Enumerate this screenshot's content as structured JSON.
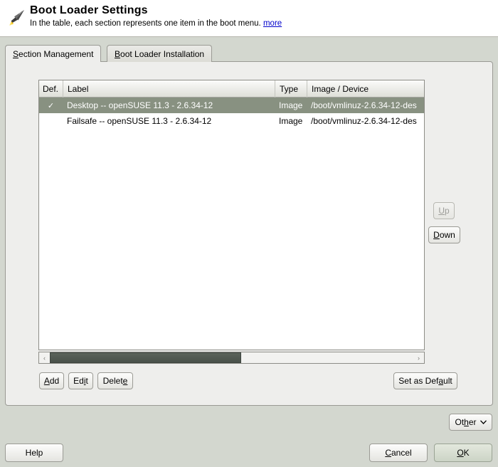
{
  "header": {
    "icon": "yast-rocket-icon",
    "title": "Boot Loader Settings",
    "subtitle": "In the table, each section represents one item in the boot menu.",
    "more_link": "more"
  },
  "tabs": [
    {
      "label": "Section Management",
      "mnemonic": "S",
      "active": true
    },
    {
      "label": "Boot Loader Installation",
      "mnemonic": "B",
      "active": false
    }
  ],
  "table": {
    "columns": [
      {
        "key": "def",
        "header": "Def."
      },
      {
        "key": "label",
        "header": "Label"
      },
      {
        "key": "type",
        "header": "Type"
      },
      {
        "key": "image",
        "header": "Image / Device"
      }
    ],
    "rows": [
      {
        "def": "✓",
        "label": "Desktop -- openSUSE 11.3 - 2.6.34-12",
        "type": "Image",
        "image": "/boot/vmlinuz-2.6.34-12-des",
        "selected": true
      },
      {
        "def": "",
        "label": "Failsafe -- openSUSE 11.3 - 2.6.34-12",
        "type": "Image",
        "image": "/boot/vmlinuz-2.6.34-12-des",
        "selected": false
      }
    ]
  },
  "scrollbar": {
    "left_arrow": "‹",
    "right_arrow": "›"
  },
  "row_buttons": {
    "add": "Add",
    "add_mnemonic": "A",
    "edit": "Edit",
    "edit_mnemonic": "i",
    "delete": "Delete",
    "delete_mnemonic": "e",
    "set_as_default": "Set as Default",
    "set_as_default_mnemonic": "a"
  },
  "order_buttons": {
    "up": "Up",
    "up_mnemonic": "U",
    "up_enabled": false,
    "down": "Down",
    "down_mnemonic": "D",
    "down_enabled": true
  },
  "other_menu": {
    "label": "Other",
    "mnemonic": "h",
    "chevron": "⌄"
  },
  "footer": {
    "help": "Help",
    "cancel": "Cancel",
    "cancel_mnemonic": "C",
    "ok": "OK",
    "ok_mnemonic": "O"
  },
  "colors": {
    "dialog_background": "#d3d7cf",
    "panel_background": "#eeeeec",
    "header_background": "#ffffff",
    "table_background": "#ffffff",
    "selected_row": "#889181",
    "link": "#0000cc",
    "default_button": "#ccd4c6",
    "scroll_thumb": "#49514a"
  }
}
